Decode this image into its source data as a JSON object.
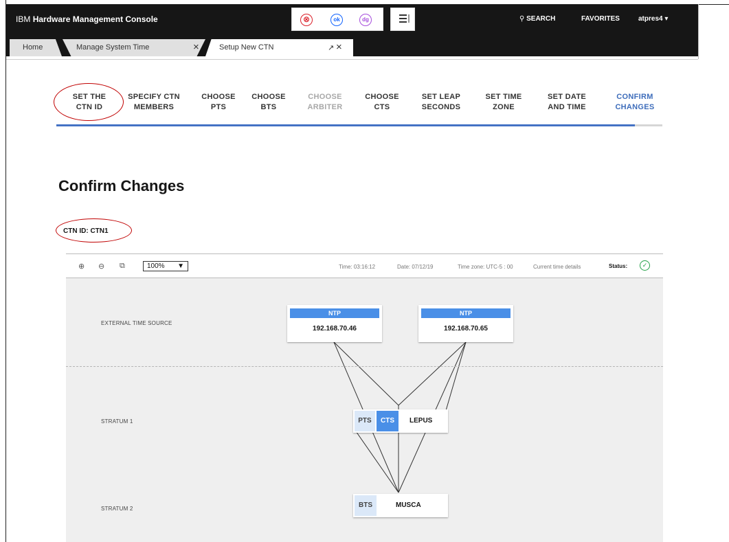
{
  "header": {
    "brand_prefix": "IBM",
    "brand_name": "Hardware Management Console",
    "tool_icons": [
      "error-icon",
      "ok-status-icon",
      "degraded-status-icon"
    ],
    "tool_icon_glyphs": [
      "⊗",
      "ok",
      "dg"
    ],
    "search_label": "SEARCH",
    "favorites_label": "FAVORITES",
    "user": "atpres4"
  },
  "tabs": [
    {
      "label": "Home"
    },
    {
      "label": "Manage System Time"
    },
    {
      "label": "Setup New CTN"
    }
  ],
  "steps": [
    {
      "line1": "SET THE",
      "line2": "CTN ID",
      "state": "done"
    },
    {
      "line1": "SPECIFY CTN",
      "line2": "MEMBERS",
      "state": "done"
    },
    {
      "line1": "CHOOSE",
      "line2": "PTS",
      "state": "done"
    },
    {
      "line1": "CHOOSE",
      "line2": "BTS",
      "state": "done"
    },
    {
      "line1": "CHOOSE",
      "line2": "ARBITER",
      "state": "disabled"
    },
    {
      "line1": "CHOOSE",
      "line2": "CTS",
      "state": "done"
    },
    {
      "line1": "SET LEAP",
      "line2": "SECONDS",
      "state": "done"
    },
    {
      "line1": "SET TIME",
      "line2": "ZONE",
      "state": "done"
    },
    {
      "line1": "SET DATE",
      "line2": "AND TIME",
      "state": "done"
    },
    {
      "line1": "CONFIRM",
      "line2": "CHANGES",
      "state": "current"
    }
  ],
  "page_title": "Confirm Changes",
  "ctn_id_text": "CTN ID: CTN1",
  "topology": {
    "zoom_level": "100%",
    "time": "Time: 03:16:12",
    "date": "Date: 07/12/19",
    "time_zone": "Time zone: UTC-5 : 00",
    "current_time_details": "Current time details",
    "status_label": "Status:",
    "levels": {
      "external": "EXTERNAL TIME SOURCE",
      "stratum1": "STRATUM 1",
      "stratum2": "STRATUM 2"
    },
    "ntp_sources": [
      {
        "type": "NTP",
        "ip": "192.168.70.46"
      },
      {
        "type": "NTP",
        "ip": "192.168.70.65"
      }
    ],
    "stratum1_system": {
      "roles": [
        "PTS",
        "CTS"
      ],
      "name": "LEPUS"
    },
    "stratum2_system": {
      "roles": [
        "BTS"
      ],
      "name": "MUSCA"
    }
  },
  "colors": {
    "accent": "#4472c4",
    "ntp_blue": "#4a8fe7",
    "annotation_red": "#c00000",
    "status_green": "#24a148"
  }
}
